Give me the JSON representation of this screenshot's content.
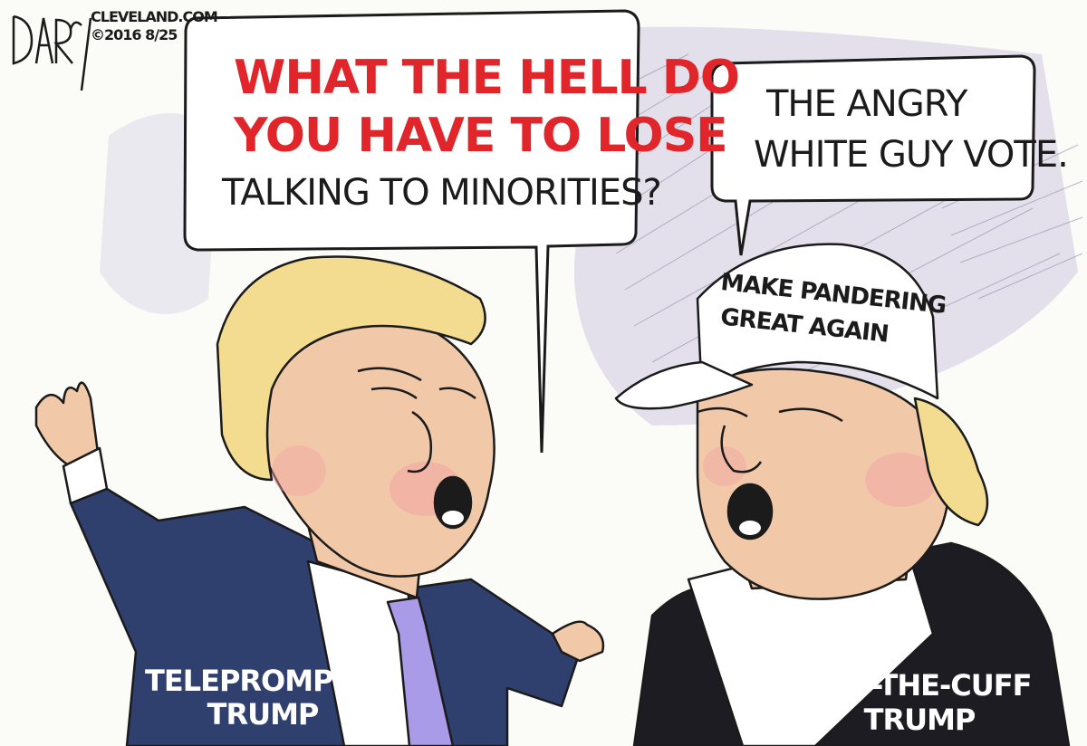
{
  "signature": "DARCY",
  "credit_line_1": "CLEVELAND.COM",
  "credit_line_2": "©2016 8/25",
  "left_bubble": {
    "line1": "WHAT THE HELL DO",
    "line2": "YOU HAVE TO LOSE",
    "line3": "TALKING TO MINORITIES?"
  },
  "right_bubble": {
    "line1": "THE ANGRY",
    "line2": "WHITE GUY VOTE."
  },
  "hat_text": {
    "line1": "MAKE PANDERING",
    "line2": "GREAT AGAIN"
  },
  "left_label": {
    "line1": "TELEPROMPTER",
    "line2": "TRUMP"
  },
  "right_label": {
    "line1": "OFF-THE-CUFF",
    "line2": "TRUMP"
  },
  "colors": {
    "background": "#fbfbf8",
    "scribble": "#9a95b5",
    "skin": "#f2c9a8",
    "hair": "#f3dc8f",
    "navy_suit": "#2f3f6e",
    "black_suit": "#1c1c22",
    "tie": "#a99be8",
    "red_text": "#e0262b"
  }
}
